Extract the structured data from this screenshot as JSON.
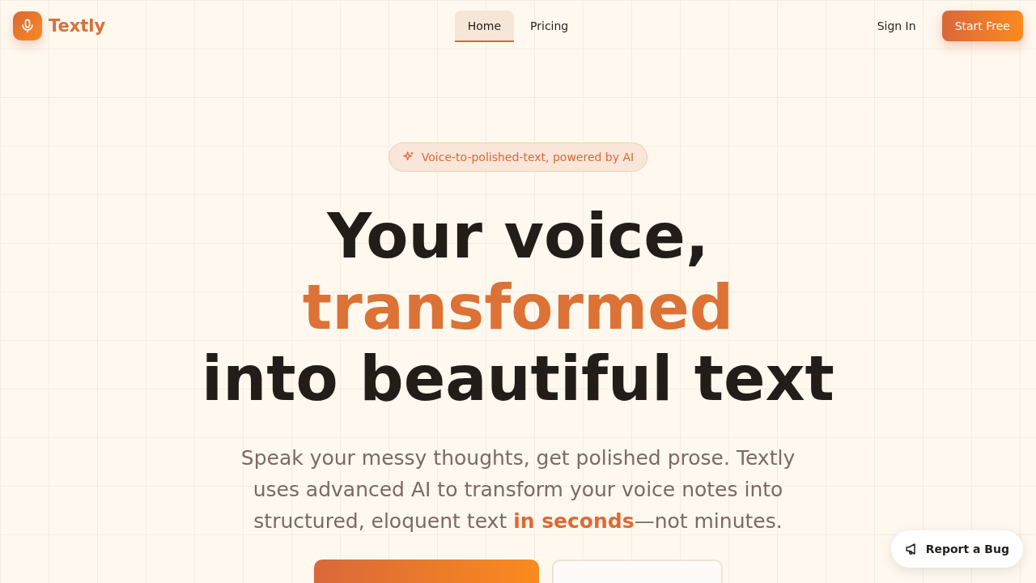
{
  "brand": {
    "name": "Textly"
  },
  "nav": [
    {
      "label": "Home",
      "selected": true
    },
    {
      "label": "Pricing",
      "selected": false
    }
  ],
  "header_actions": {
    "sign_in": "Sign In",
    "cta": "Start Free"
  },
  "hero": {
    "badge": "Voice-to-polished-text, powered by AI",
    "title_lines": [
      {
        "text": "Your voice,",
        "accent": false
      },
      {
        "text": "transformed",
        "accent": true
      },
      {
        "text": "into beautiful text",
        "accent": false
      }
    ],
    "subtitle": "Speak your messy thoughts, get polished prose. Textly uses advanced AI to transform your voice notes into structured, eloquent text **in seconds**—not minutes.",
    "buttons": [
      {
        "kind": "primary"
      },
      {
        "kind": "secondary"
      }
    ]
  },
  "report_button": "Report a Bug"
}
